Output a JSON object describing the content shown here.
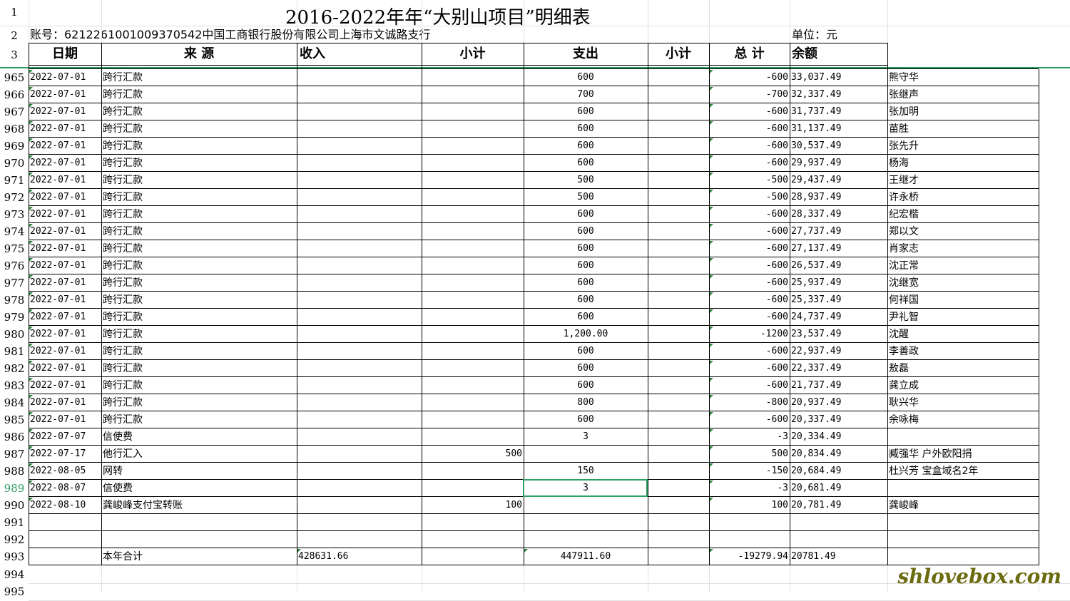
{
  "title": "2016-2022年年“大别山项目”明细表",
  "account": "账号：6212261001009370542中国工商银行股份有限公司上海市文诚路支行",
  "unit": "单位：元",
  "row_numbers": {
    "r1": "1",
    "r2": "2",
    "r3": "3",
    "r994": "994",
    "r995": "995"
  },
  "headers": {
    "date": "日期",
    "source": "来 源",
    "income": "收入",
    "subtotal1": "小计",
    "expense": "支出",
    "subtotal2": "小计",
    "total": "总 计",
    "balance": "余额"
  },
  "rows": [
    {
      "n": "965",
      "date": "2022-07-01",
      "source": "跨行汇款",
      "income": "",
      "expense": "600",
      "total": "-600",
      "balance": "33,037.49",
      "note": "熊守华"
    },
    {
      "n": "966",
      "date": "2022-07-01",
      "source": "跨行汇款",
      "income": "",
      "expense": "700",
      "total": "-700",
      "balance": "32,337.49",
      "note": "张继声"
    },
    {
      "n": "967",
      "date": "2022-07-01",
      "source": "跨行汇款",
      "income": "",
      "expense": "600",
      "total": "-600",
      "balance": "31,737.49",
      "note": "张加明"
    },
    {
      "n": "968",
      "date": "2022-07-01",
      "source": "跨行汇款",
      "income": "",
      "expense": "600",
      "total": "-600",
      "balance": "31,137.49",
      "note": "苗胜"
    },
    {
      "n": "969",
      "date": "2022-07-01",
      "source": "跨行汇款",
      "income": "",
      "expense": "600",
      "total": "-600",
      "balance": "30,537.49",
      "note": "张先升"
    },
    {
      "n": "970",
      "date": "2022-07-01",
      "source": "跨行汇款",
      "income": "",
      "expense": "600",
      "total": "-600",
      "balance": "29,937.49",
      "note": "杨海"
    },
    {
      "n": "971",
      "date": "2022-07-01",
      "source": "跨行汇款",
      "income": "",
      "expense": "500",
      "total": "-500",
      "balance": "29,437.49",
      "note": "王继才"
    },
    {
      "n": "972",
      "date": "2022-07-01",
      "source": "跨行汇款",
      "income": "",
      "expense": "500",
      "total": "-500",
      "balance": "28,937.49",
      "note": "许永桥"
    },
    {
      "n": "973",
      "date": "2022-07-01",
      "source": "跨行汇款",
      "income": "",
      "expense": "600",
      "total": "-600",
      "balance": "28,337.49",
      "note": "纪宏楷"
    },
    {
      "n": "974",
      "date": "2022-07-01",
      "source": "跨行汇款",
      "income": "",
      "expense": "600",
      "total": "-600",
      "balance": "27,737.49",
      "note": "郑以文"
    },
    {
      "n": "975",
      "date": "2022-07-01",
      "source": "跨行汇款",
      "income": "",
      "expense": "600",
      "total": "-600",
      "balance": "27,137.49",
      "note": "肖家志"
    },
    {
      "n": "976",
      "date": "2022-07-01",
      "source": "跨行汇款",
      "income": "",
      "expense": "600",
      "total": "-600",
      "balance": "26,537.49",
      "note": "沈正常"
    },
    {
      "n": "977",
      "date": "2022-07-01",
      "source": "跨行汇款",
      "income": "",
      "expense": "600",
      "total": "-600",
      "balance": "25,937.49",
      "note": "沈继宽"
    },
    {
      "n": "978",
      "date": "2022-07-01",
      "source": "跨行汇款",
      "income": "",
      "expense": "600",
      "total": "-600",
      "balance": "25,337.49",
      "note": "何祥国"
    },
    {
      "n": "979",
      "date": "2022-07-01",
      "source": "跨行汇款",
      "income": "",
      "expense": "600",
      "total": "-600",
      "balance": "24,737.49",
      "note": "尹礼智"
    },
    {
      "n": "980",
      "date": "2022-07-01",
      "source": "跨行汇款",
      "income": "",
      "expense": "1,200.00",
      "total": "-1200",
      "balance": "23,537.49",
      "note": "沈醒"
    },
    {
      "n": "981",
      "date": "2022-07-01",
      "source": "跨行汇款",
      "income": "",
      "expense": "600",
      "total": "-600",
      "balance": "22,937.49",
      "note": "李善政"
    },
    {
      "n": "982",
      "date": "2022-07-01",
      "source": "跨行汇款",
      "income": "",
      "expense": "600",
      "total": "-600",
      "balance": "22,337.49",
      "note": "敖磊"
    },
    {
      "n": "983",
      "date": "2022-07-01",
      "source": "跨行汇款",
      "income": "",
      "expense": "600",
      "total": "-600",
      "balance": "21,737.49",
      "note": "龚立成"
    },
    {
      "n": "984",
      "date": "2022-07-01",
      "source": "跨行汇款",
      "income": "",
      "expense": "800",
      "total": "-800",
      "balance": "20,937.49",
      "note": "耿兴华"
    },
    {
      "n": "985",
      "date": "2022-07-01",
      "source": "跨行汇款",
      "income": "",
      "expense": "600",
      "total": "-600",
      "balance": "20,337.49",
      "note": "余咏梅"
    },
    {
      "n": "986",
      "date": "2022-07-07",
      "source": "信使费",
      "income": "",
      "expense": "3",
      "total": "-3",
      "balance": "20,334.49",
      "note": ""
    },
    {
      "n": "987",
      "date": "2022-07-17",
      "source": "他行汇入",
      "income": "500",
      "expense": "",
      "total": "500",
      "balance": "20,834.49",
      "note": "臧强华 户外欧阳捐"
    },
    {
      "n": "988",
      "date": "2022-08-05",
      "source": "网转",
      "income": "",
      "expense": "150",
      "total": "-150",
      "balance": "20,684.49",
      "note": "杜兴芳  宝盒域名2年"
    },
    {
      "n": "989",
      "date": "2022-08-07",
      "source": "信使费",
      "income": "",
      "expense": "3",
      "total": "-3",
      "balance": "20,681.49",
      "note": "",
      "selected": true
    },
    {
      "n": "990",
      "date": "2022-08-10",
      "source": "龚峻峰支付宝转账",
      "income": "100",
      "expense": "",
      "total": "100",
      "balance": "20,781.49",
      "note": "龚峻峰"
    },
    {
      "n": "991",
      "date": "",
      "source": "",
      "income": "",
      "expense": "",
      "total": "",
      "balance": "",
      "note": ""
    },
    {
      "n": "992",
      "date": "",
      "source": "",
      "income": "",
      "expense": "",
      "total": "",
      "balance": "",
      "note": ""
    },
    {
      "n": "993",
      "date": "",
      "source": "本年合计",
      "income": "428631.66",
      "expense": "447911.60",
      "total": "-19279.94",
      "balance": "20781.49",
      "note": ""
    }
  ],
  "watermark": "shlovebox.com",
  "colors": {
    "selection": "#2e9e61",
    "freeze_line": "#2e9e61",
    "grid": "#e2e2e2",
    "watermark": "#6b6b10"
  }
}
